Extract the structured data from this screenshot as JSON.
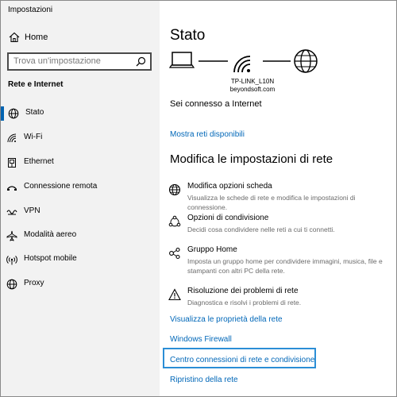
{
  "app_title": "Impostazioni",
  "home_label": "Home",
  "search": {
    "placeholder": "Trova un'impostazione"
  },
  "section_title": "Rete e Internet",
  "nav": [
    {
      "label": "Stato",
      "icon": "globe-icon"
    },
    {
      "label": "Wi-Fi",
      "icon": "wifi-icon"
    },
    {
      "label": "Ethernet",
      "icon": "ethernet-icon"
    },
    {
      "label": "Connessione remota",
      "icon": "dialup-icon"
    },
    {
      "label": "VPN",
      "icon": "vpn-icon"
    },
    {
      "label": "Modalità aereo",
      "icon": "airplane-icon"
    },
    {
      "label": "Hotspot mobile",
      "icon": "hotspot-icon"
    },
    {
      "label": "Proxy",
      "icon": "globe-icon"
    }
  ],
  "main": {
    "title": "Stato",
    "network_name": "TP-LINK_L10N",
    "network_domain": "beyondsoft.com",
    "connected_text": "Sei connesso a Internet",
    "show_networks_link": "Mostra reti disponibili",
    "section_title": "Modifica le impostazioni di rete",
    "options": [
      {
        "title": "Modifica opzioni scheda",
        "desc": "Visualizza le schede di rete e modifica le impostazioni di connessione."
      },
      {
        "title": "Opzioni di condivisione",
        "desc": "Decidi cosa condividere nelle reti a cui ti connetti."
      },
      {
        "title": "Gruppo Home",
        "desc": "Imposta un gruppo home per condividere immagini, musica, file e stampanti con altri PC della rete."
      },
      {
        "title": "Risoluzione dei problemi di rete",
        "desc": "Diagnostica e risolvi i problemi di rete."
      }
    ],
    "links": [
      "Visualizza le proprietà della rete",
      "Windows Firewall",
      "Centro connessioni di rete e condivisione",
      "Ripristino della rete"
    ]
  },
  "colors": {
    "accent": "#0067b8",
    "focus": "#2b8ed6",
    "sidebar_bg": "#f2f2f2"
  }
}
